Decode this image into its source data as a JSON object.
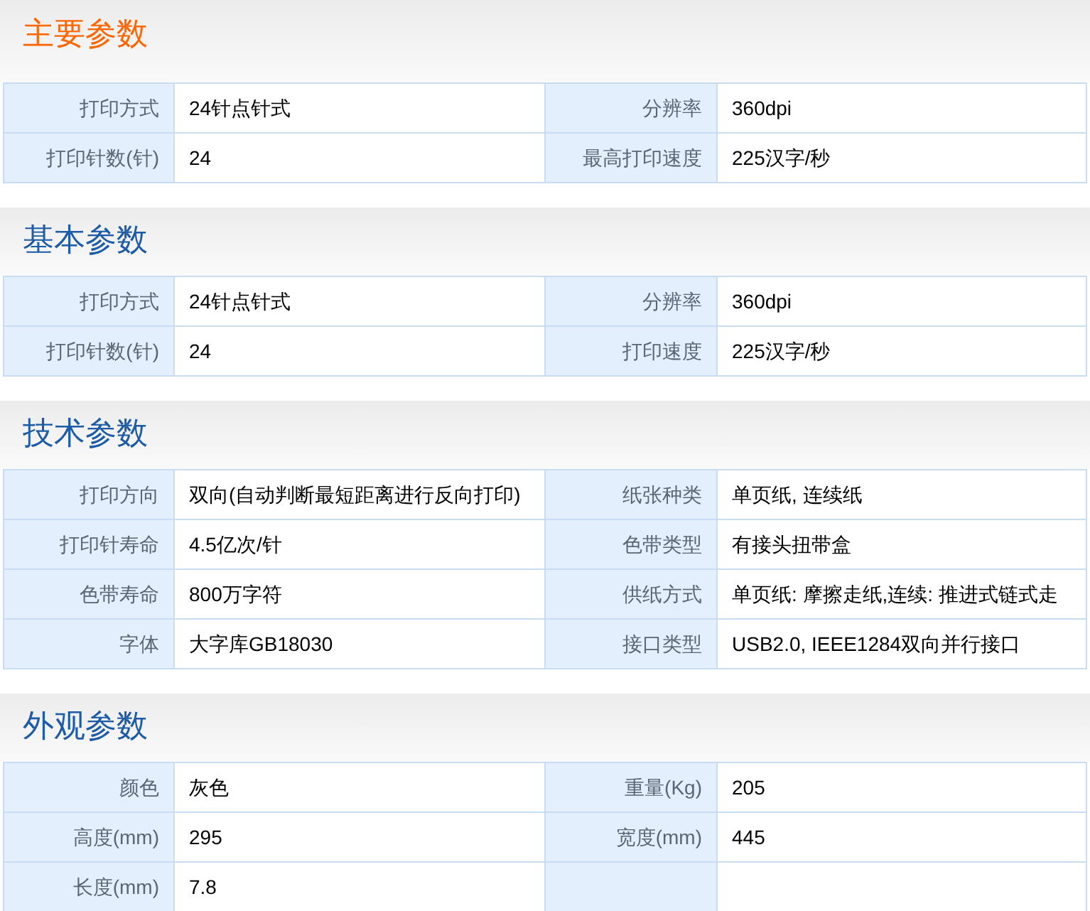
{
  "sections": [
    {
      "title": "主要参数",
      "highlight": true,
      "rows": [
        [
          {
            "label": "打印方式",
            "value": "24针点针式"
          },
          {
            "label": "分辨率",
            "value": "360dpi"
          }
        ],
        [
          {
            "label": "打印针数(针)",
            "value": "24"
          },
          {
            "label": "最高打印速度",
            "value": "225汉字/秒"
          }
        ]
      ]
    },
    {
      "title": "基本参数",
      "highlight": false,
      "rows": [
        [
          {
            "label": "打印方式",
            "value": "24针点针式"
          },
          {
            "label": "分辨率",
            "value": "360dpi"
          }
        ],
        [
          {
            "label": "打印针数(针)",
            "value": "24"
          },
          {
            "label": "打印速度",
            "value": "225汉字/秒"
          }
        ]
      ]
    },
    {
      "title": "技术参数",
      "highlight": false,
      "rows": [
        [
          {
            "label": "打印方向",
            "value": "双向(自动判断最短距离进行反向打印)"
          },
          {
            "label": "纸张种类",
            "value": "单页纸, 连续纸"
          }
        ],
        [
          {
            "label": "打印针寿命",
            "value": "4.5亿次/针"
          },
          {
            "label": "色带类型",
            "value": "有接头扭带盒"
          }
        ],
        [
          {
            "label": "色带寿命",
            "value": "800万字符"
          },
          {
            "label": "供纸方式",
            "value": "单页纸: 摩擦走纸,连续: 推进式链式走"
          }
        ],
        [
          {
            "label": "字体",
            "value": "大字库GB18030"
          },
          {
            "label": "接口类型",
            "value": "USB2.0, IEEE1284双向并行接口"
          }
        ]
      ]
    },
    {
      "title": "外观参数",
      "highlight": false,
      "rows": [
        [
          {
            "label": "颜色",
            "value": "灰色"
          },
          {
            "label": "重量(Kg)",
            "value": "205"
          }
        ],
        [
          {
            "label": "高度(mm)",
            "value": "295"
          },
          {
            "label": "宽度(mm)",
            "value": "445"
          }
        ],
        [
          {
            "label": "长度(mm)",
            "value": "7.8"
          }
        ]
      ]
    }
  ]
}
